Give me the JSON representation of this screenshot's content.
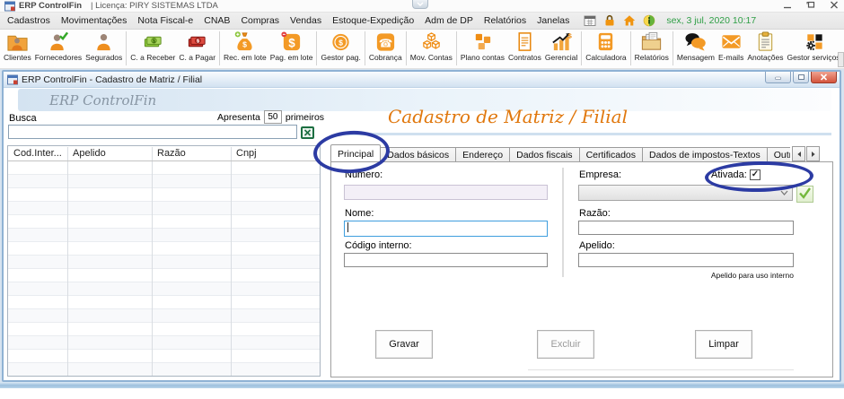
{
  "colors": {
    "accent_orange": "#ef8d14",
    "datetime_green": "#2e9e45",
    "form_title_orange": "#e0770c",
    "annotation_blue": "#2c3ba3"
  },
  "title_bar": {
    "app_title": "ERP ControlFin",
    "license": "| Licença: PIRY SISTEMAS LTDA"
  },
  "menu": {
    "items": [
      "Cadastros",
      "Movimentações",
      "Nota Fiscal-e",
      "CNAB",
      "Compras",
      "Vendas",
      "Estoque-Expedição",
      "Adm de DP",
      "Relatórios",
      "Janelas"
    ],
    "status_icons": [
      "calendar-grid-icon",
      "lock-icon",
      "home-icon",
      "info-icon"
    ],
    "datetime": "sex, 3 jul, 2020  10:17"
  },
  "toolbar": {
    "items": [
      {
        "label": "Clientes",
        "icon": "clientes-icon"
      },
      {
        "label": "Fornecedores",
        "icon": "fornecedores-icon"
      },
      {
        "label": "Segurados",
        "icon": "segurados-icon"
      },
      {
        "label": "C. a Receber",
        "icon": "contas-receber-icon"
      },
      {
        "label": "C. a Pagar",
        "icon": "contas-pagar-icon"
      },
      {
        "label": "Rec. em lote",
        "icon": "receber-lote-icon"
      },
      {
        "label": "Pag. em lote",
        "icon": "pagar-lote-icon"
      },
      {
        "label": "Gestor pag.",
        "icon": "gestor-pagamentos-icon"
      },
      {
        "label": "Cobrança",
        "icon": "cobranca-icon"
      },
      {
        "label": "Mov. Contas",
        "icon": "mov-contas-icon"
      },
      {
        "label": "Plano contas",
        "icon": "plano-contas-icon"
      },
      {
        "label": "Contratos",
        "icon": "contratos-icon"
      },
      {
        "label": "Gerencial",
        "icon": "gerencial-icon"
      },
      {
        "label": "Calculadora",
        "icon": "calculadora-icon"
      },
      {
        "label": "Relatórios",
        "icon": "relatorios-icon"
      },
      {
        "label": "Mensagem",
        "icon": "mensagem-icon"
      },
      {
        "label": "E-mails",
        "icon": "emails-icon"
      },
      {
        "label": "Anotações",
        "icon": "anotacoes-icon"
      },
      {
        "label": "Gestor serviços",
        "icon": "gestor-servicos-icon"
      }
    ]
  },
  "mdi_window": {
    "title": "ERP ControlFin - Cadastro de Matriz / Filial",
    "banner": "ERP ControlFin",
    "search": {
      "label": "Busca",
      "apresenta": "Apresenta",
      "count": "50",
      "primeiros": "primeiros",
      "value": "",
      "export_icon": "excel-export-icon"
    },
    "list": {
      "columns": [
        "Cod.Inter...",
        "Apelido",
        "Razão",
        "Cnpj"
      ],
      "rows": []
    },
    "form": {
      "title": "Cadastro de Matriz / Filial",
      "tabs": [
        "Principal",
        "Dados básicos",
        "Endereço",
        "Dados fiscais",
        "Certificados",
        "Dados de impostos-Textos",
        "Outros dad"
      ],
      "active_tab": "Principal",
      "numero_label": "Número:",
      "numero_value": "",
      "nome_label": "Nome:",
      "nome_value": "",
      "codigo_interno_label": "Código interno:",
      "codigo_interno_value": "",
      "empresa_label": "Empresa:",
      "empresa_value": "",
      "ativada_label": "Ativada:",
      "ativada_check": "✓",
      "razao_label": "Razão:",
      "razao_value": "",
      "apelido_label": "Apelido:",
      "apelido_value": "",
      "apelido_note": "Apelido para uso interno",
      "buttons": {
        "gravar": "Gravar",
        "excluir": "Excluir",
        "limpar": "Limpar"
      }
    }
  }
}
